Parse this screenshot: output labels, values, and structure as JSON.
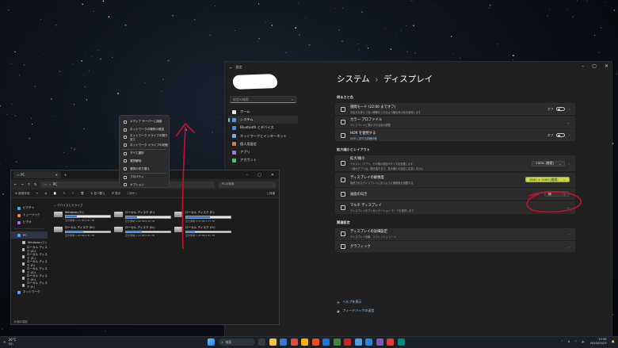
{
  "settings": {
    "window_back": "←",
    "window_title": "設定",
    "search_placeholder": "設定の検索",
    "nav": [
      {
        "label": "ホーム",
        "color": "#e8e8e8"
      },
      {
        "label": "システム",
        "color": "#3aa0ff"
      },
      {
        "label": "Bluetooth とデバイス",
        "color": "#3a8dff"
      },
      {
        "label": "ネットワークとインターネット",
        "color": "#6ab1ff"
      },
      {
        "label": "個人用設定",
        "color": "#e07a3a"
      },
      {
        "label": "アプリ",
        "color": "#a07ad0"
      },
      {
        "label": "アカウント",
        "color": "#4cc07a"
      }
    ],
    "breadcrumb_parent": "システム",
    "breadcrumb_sep": "›",
    "breadcrumb_current": "ディスプレイ",
    "sections": {
      "brightness": "明るさと色",
      "scale_layout": "拡大縮小とレイアウト",
      "related": "関連設定"
    },
    "cards": {
      "night_light": {
        "title": "夜間モード (22:00 までオフ)",
        "sub": "青色光を抑えて良い睡眠をとれるよう暖色系の色を使用します",
        "state": "オフ"
      },
      "color_profile": {
        "title": "カラー プロファイル",
        "sub": "ディスプレイに表示される色の調整"
      },
      "hdr": {
        "title": "HDR を使用する",
        "link": "HDR に関する詳細情報",
        "state": "オフ"
      },
      "scale": {
        "title": "拡大/縮小",
        "sub": "テキスト、アプリ、その他の項目のサイズを変更します",
        "sub2": "一部のアプリは、開き直すまで、拡大縮小の設定に応答しません",
        "value": "150% (推奨)"
      },
      "resolution": {
        "title": "ディスプレイの解像度",
        "sub": "接続されたディスプレイに合うように解像度を調整する",
        "value": "3840 × 2160 (推奨)"
      },
      "orientation": {
        "title": "画面の向き",
        "value": "横"
      },
      "multi": {
        "title": "マルチ ディスプレイ",
        "sub": "ディスプレイのプレゼンテーション モードを選択します"
      },
      "advanced": {
        "title": "ディスプレイの詳細設定",
        "sub": "ディスプレイ情報、リフレッシュ レート"
      },
      "graphics": {
        "title": "グラフィック"
      }
    },
    "links": {
      "help": "ヘルプを表示",
      "feedback": "フィードバックの送信"
    }
  },
  "explorer": {
    "tab_title": "PC",
    "tab_new": "+",
    "address": "PC",
    "address_sep": "›",
    "search_placeholder": "PCの検索",
    "toolbar": {
      "new": "新規作成",
      "sort": "並べ替え",
      "view": "表示",
      "more": "•••",
      "details": "詳細"
    },
    "sidebar": [
      {
        "label": "ピクチャ",
        "color": "#4aa3ff"
      },
      {
        "label": "ミュージック",
        "color": "#ff7a5c"
      },
      {
        "label": "ビデオ",
        "color": "#9b6bff"
      },
      {
        "label": "PC",
        "color": "#4aa3ff"
      },
      {
        "label": "Windows (C:)",
        "color": "#bbb"
      },
      {
        "label": "ローカル ディスク (D:)",
        "color": "#bbb"
      },
      {
        "label": "ローカル ディスク (E:)",
        "color": "#bbb"
      },
      {
        "label": "ローカル ディスク (F:)",
        "color": "#bbb"
      },
      {
        "label": "ローカル ディスク (G:)",
        "color": "#bbb"
      },
      {
        "label": "ローカル ディスク (H:)",
        "color": "#bbb"
      },
      {
        "label": "ローカル ディスク (I:)",
        "color": "#bbb"
      },
      {
        "label": "ネットワーク",
        "color": "#4aa3ff"
      }
    ],
    "group_label": "デバイスとドライブ",
    "drives": [
      {
        "name": "Windows (C:)",
        "free": "空き領域 1.37 TB/1.81 TB",
        "used": 0.25
      },
      {
        "name": "ローカル ディスク (E:)",
        "free": "空き領域 4.08 TB/5.45 TB",
        "used": 0.25
      },
      {
        "name": "ローカル ディスク (F:)",
        "free": "空き領域 3.33 TB/7.27 TB",
        "used": 0.54
      },
      {
        "name": "ローカル ディスク (D:)",
        "free": "空き領域 1.09 TB/1.81 TB",
        "used": 0.4
      },
      {
        "name": "ローカル ディスク (G:)",
        "free": "空き領域 1.16 TB/1.81 TB",
        "used": 0.36
      },
      {
        "name": "ローカル ディスク (H:)",
        "free": "空き領域 1.44 TB/1.81 TB",
        "used": 0.2
      }
    ],
    "status": "6 個の項目"
  },
  "context_menu": [
    "メディア サーバーに接続",
    "ネットワークの場所の追加",
    "ネットワーク ドライブの割り当て",
    "ネットワーク ドライブの切断",
    "すべて選択",
    "選択解除",
    "選択の切り替え",
    "プロパティ",
    "オプション"
  ],
  "taskbar": {
    "temp": "26°C",
    "weather": "晴れ",
    "search": "検索",
    "ime": "A",
    "time": "19:58",
    "date": "2025/05/23"
  }
}
